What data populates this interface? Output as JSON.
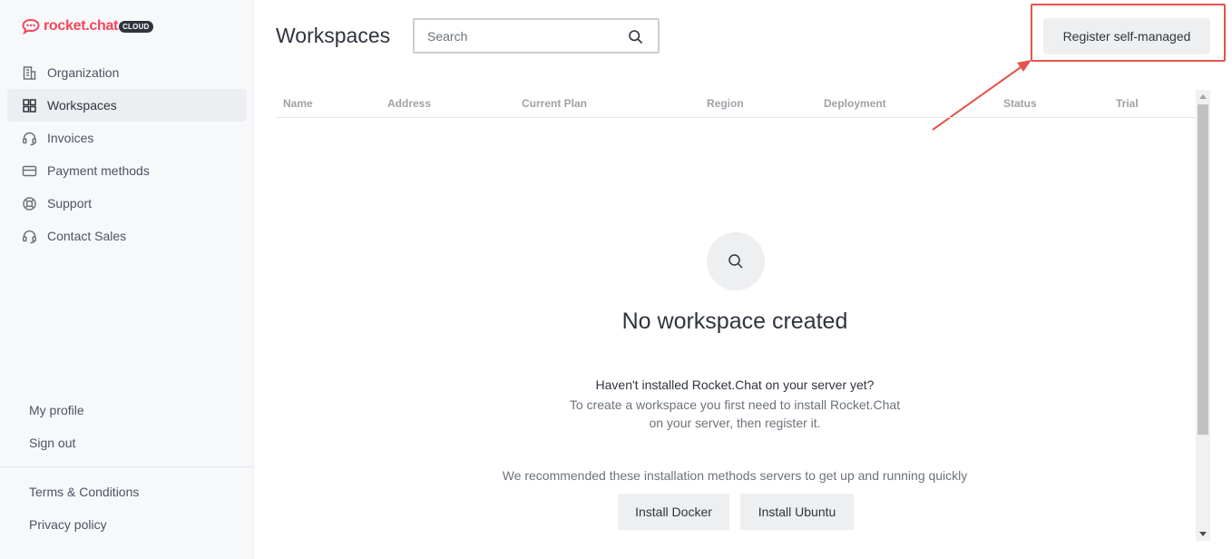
{
  "brand": {
    "name": "rocket.chat",
    "badge": "CLOUD",
    "color": "#f5455c"
  },
  "sidebar": {
    "items": [
      {
        "label": "Organization",
        "icon": "building-icon"
      },
      {
        "label": "Workspaces",
        "icon": "grid-icon",
        "active": true
      },
      {
        "label": "Invoices",
        "icon": "headset-icon"
      },
      {
        "label": "Payment methods",
        "icon": "credit-card-icon"
      },
      {
        "label": "Support",
        "icon": "lifebuoy-icon"
      },
      {
        "label": "Contact Sales",
        "icon": "headset-icon"
      }
    ],
    "account_links": [
      "My profile",
      "Sign out"
    ],
    "legal_links": [
      "Terms & Conditions",
      "Privacy policy"
    ]
  },
  "main": {
    "title": "Workspaces",
    "search": {
      "placeholder": "Search",
      "value": ""
    },
    "register_button": "Register self-managed",
    "table_columns": [
      "Name",
      "Address",
      "Current Plan",
      "Region",
      "Deployment",
      "Status",
      "Trial"
    ],
    "empty_state": {
      "title": "No workspace created",
      "question": "Haven't installed Rocket.Chat on your server yet?",
      "description_line1": "To create a workspace you first need to install Rocket.Chat",
      "description_line2": "on your server, then register it.",
      "recommendation": "We recommended these installation methods servers to get up and running quickly",
      "buttons": [
        "Install Docker",
        "Install Ubuntu"
      ]
    }
  },
  "annotation": {
    "color": "#e5534b",
    "target": "register-self-managed-button"
  }
}
